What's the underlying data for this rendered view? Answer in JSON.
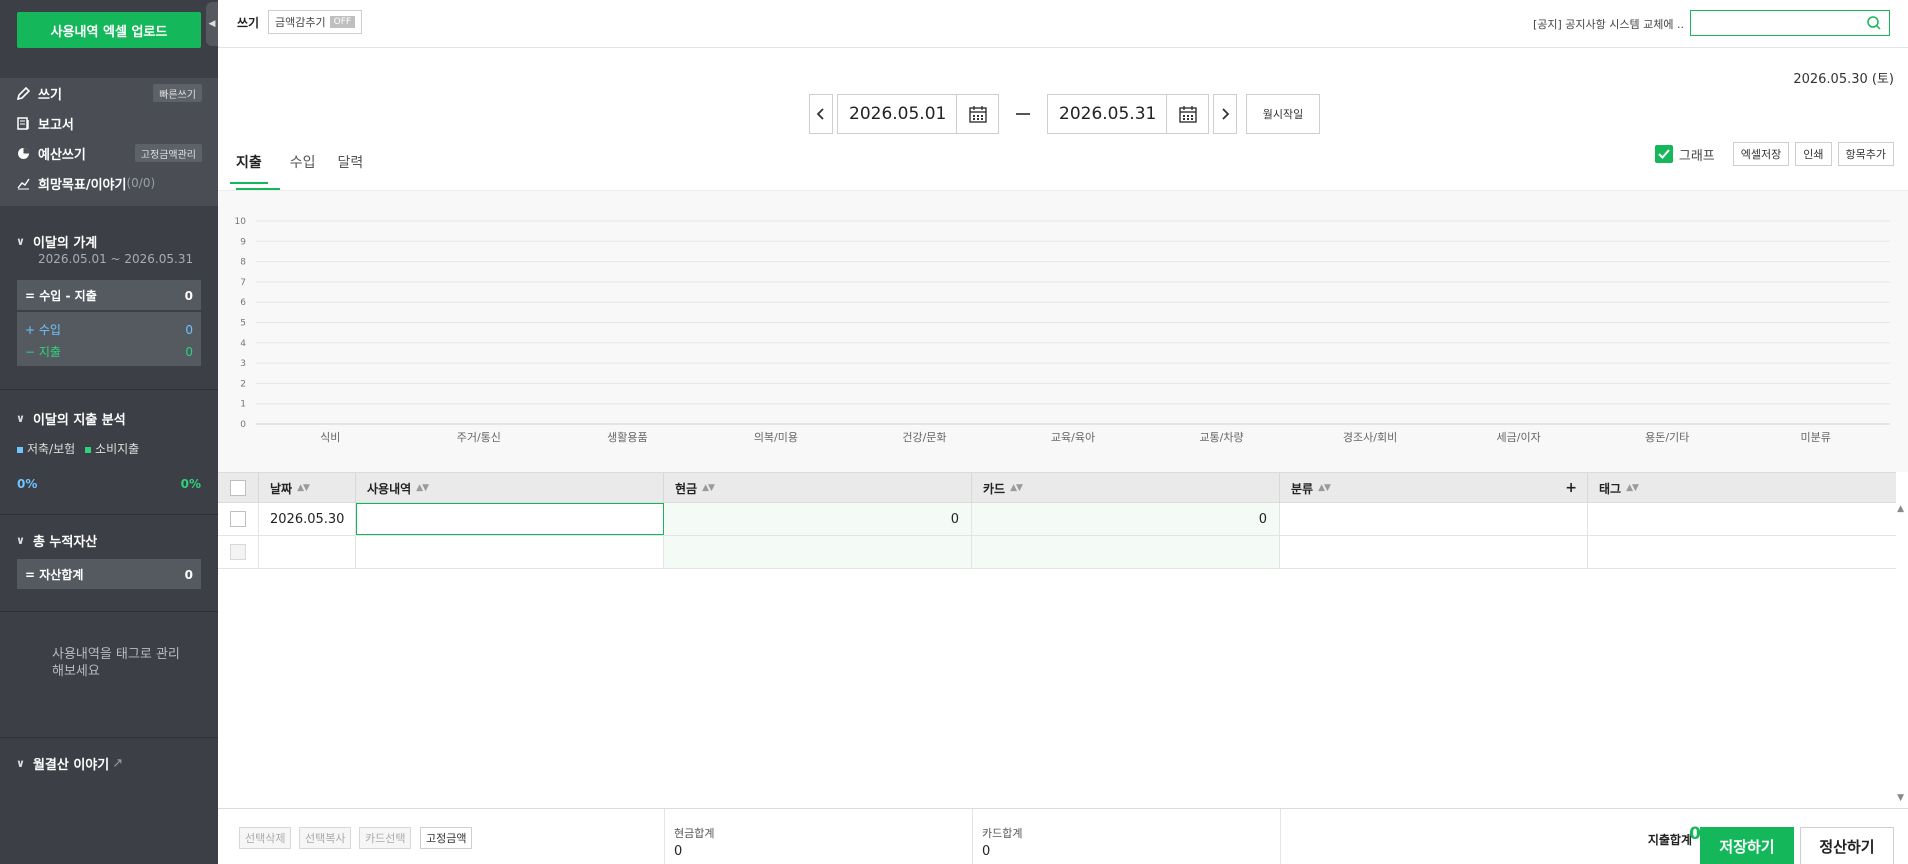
{
  "sidebar": {
    "upload_label": "사용내역 엑셀 업로드",
    "menu": {
      "write": "쓰기",
      "write_pill": "빠른쓰기",
      "report": "보고서",
      "budget": "예산쓰기",
      "budget_pill": "고정금액관리",
      "goal": "희망목표/이야기",
      "goal_count": "(0/0)"
    },
    "monthly": {
      "title": "이달의 가계",
      "range": "2026.05.01 ~ 2026.05.31",
      "net_label": "= 수입 - 지출",
      "net_value": "0",
      "income_label": "+ 수입",
      "income_value": "0",
      "expense_label": "− 지출",
      "expense_value": "0"
    },
    "analysis": {
      "title": "이달의 지출 분석",
      "legend_saving": "저축/보험",
      "legend_consumption": "소비지출",
      "saving_pct": "0%",
      "consumption_pct": "0%"
    },
    "assets": {
      "title": "총 누적자산",
      "total_label": "= 자산합계",
      "total_value": "0"
    },
    "tag_note": "사용내역을 태그로 관리해보세요",
    "story": "월결산 이야기",
    "story_arrow": "↗"
  },
  "topbar": {
    "write_label": "쓰기",
    "hide_amount_label": "금액감추기",
    "hide_amount_state": "OFF",
    "notice": "[공지] 공지사항 시스템 교체에 ..",
    "search_placeholder": ""
  },
  "date": {
    "today": "2026.05.30 (토)",
    "start": "2026.05.01",
    "end": "2026.05.31",
    "month_start_label": "월시작일"
  },
  "tabs": [
    {
      "label": "지출",
      "active": true
    },
    {
      "label": "수입",
      "active": false
    },
    {
      "label": "달력",
      "active": false
    }
  ],
  "tools": {
    "graph_label": "그래프",
    "excel_label": "엑셀저장",
    "print_label": "인쇄",
    "add_item_label": "항목추가"
  },
  "chart_data": {
    "type": "bar",
    "categories": [
      "식비",
      "주거/통신",
      "생활용품",
      "의복/미용",
      "건강/문화",
      "교육/육아",
      "교통/차량",
      "경조사/회비",
      "세금/이자",
      "용돈/기타",
      "미분류"
    ],
    "values": [
      0,
      0,
      0,
      0,
      0,
      0,
      0,
      0,
      0,
      0,
      0
    ],
    "ylim": [
      0,
      10
    ],
    "yticks": [
      "0",
      "1",
      "2",
      "3",
      "4",
      "5",
      "6",
      "7",
      "8",
      "9",
      "10"
    ],
    "grid": true,
    "bar_color": "#14b85a"
  },
  "table": {
    "headers": {
      "date": "날짜",
      "desc": "사용내역",
      "cash": "현금",
      "card": "카드",
      "category": "분류",
      "category_add": "+",
      "tag": "태그"
    },
    "rows": [
      {
        "date": "2026.05.30",
        "desc": "",
        "cash": "0",
        "card": "0",
        "category": "",
        "tag": ""
      }
    ]
  },
  "footer": {
    "delete_label": "선택삭제",
    "copy_label": "선택복사",
    "card_label": "카드선택",
    "fixed_label": "고정금액",
    "cash_total_label": "현금합계",
    "cash_total_value": "0",
    "card_total_label": "카드합계",
    "card_total_value": "0",
    "expense_total_label": "지출합계",
    "expense_total_value": "0",
    "save_label": "저장하기",
    "settle_label": "정산하기"
  },
  "colors": {
    "accent": "#14b85a",
    "sidebar": "#3c3f45",
    "income": "#6fc3ff"
  }
}
